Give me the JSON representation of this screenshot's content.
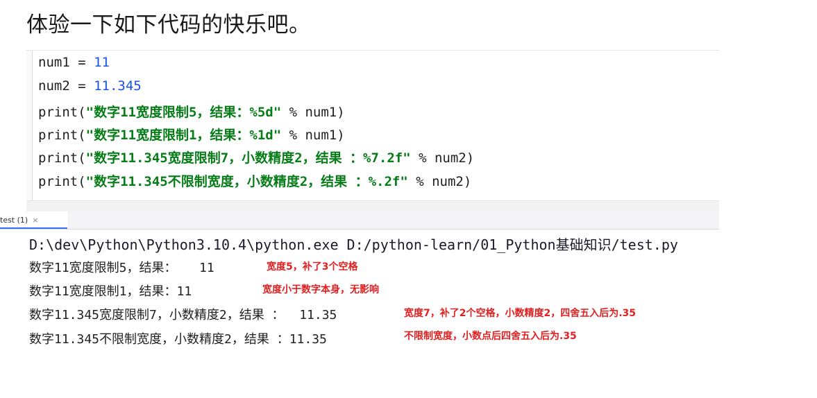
{
  "title": "体验一下如下代码的快乐吧。",
  "code": {
    "line1": {
      "var": "num1 = ",
      "value": "11"
    },
    "line2": {
      "var": "num2 = ",
      "value": "11.345"
    },
    "line3": {
      "fn": "print(",
      "str": "\"数字11宽度限制5，结果：%5d\"",
      "rest": " % num1)"
    },
    "line4": {
      "fn": "print(",
      "str": "\"数字11宽度限制1，结果：%1d\"",
      "rest": " % num1)"
    },
    "line5": {
      "fn": "print(",
      "str": "\"数字11.345宽度限制7，小数精度2，结果 ：%7.2f\"",
      "rest": " % num2)"
    },
    "line6": {
      "fn": "print(",
      "str": "\"数字11.345不限制宽度，小数精度2，结果 ：%.2f\"",
      "rest": " % num2)"
    }
  },
  "run_tab": {
    "label": "test (1)",
    "close": "×"
  },
  "console": {
    "command": "D:\\dev\\Python\\Python3.10.4\\python.exe D:/python-learn/01_Python基础知识/test.py",
    "outputs": [
      "数字11宽度限制5，结果：   11",
      "数字11宽度限制1，结果：11",
      "数字11.345宽度限制7，小数精度2，结果 ：  11.35",
      "数字11.345不限制宽度，小数精度2，结果 ：11.35"
    ]
  },
  "notes": [
    "宽度5，补了3个空格",
    "宽度小于数字本身，无影响",
    "宽度7，补了2个空格，小数精度2，四舍五入后为.35",
    "不限制宽度，小数点后四舍五入后为.35"
  ],
  "colors": {
    "string": "#067d17",
    "number": "#1750eb",
    "annotation": "#e02020"
  }
}
